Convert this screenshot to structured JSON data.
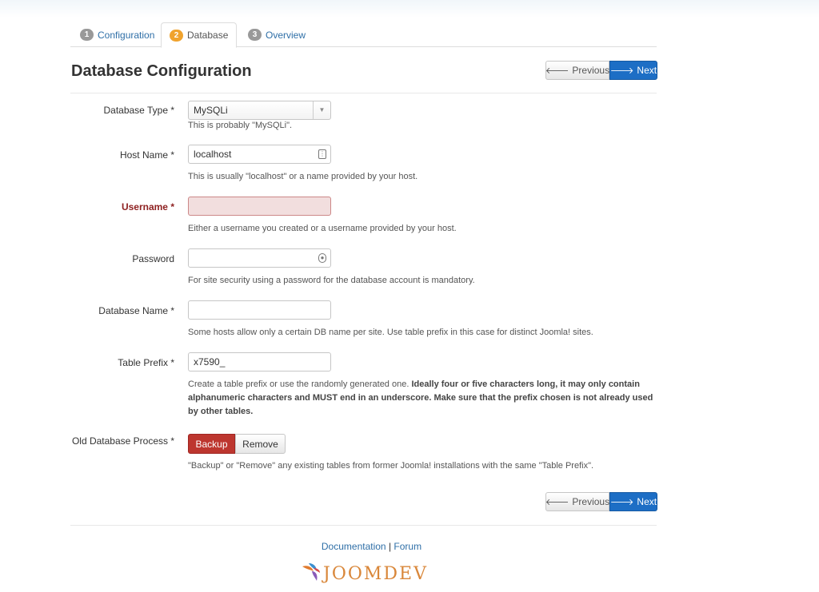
{
  "tabs": [
    {
      "num": "1",
      "label": "Configuration"
    },
    {
      "num": "2",
      "label": "Database"
    },
    {
      "num": "3",
      "label": "Overview"
    }
  ],
  "page_title": "Database Configuration",
  "nav": {
    "previous": "Previous",
    "next": "Next"
  },
  "fields": {
    "db_type": {
      "label": "Database Type *",
      "value": "MySQLi",
      "help": "This is probably \"MySQLi\"."
    },
    "host": {
      "label": "Host Name *",
      "value": "localhost",
      "help": "This is usually \"localhost\" or a name provided by your host."
    },
    "username": {
      "label": "Username *",
      "value": "",
      "help": "Either a username you created or a username provided by your host."
    },
    "password": {
      "label": "Password",
      "value": "",
      "help": "For site security using a password for the database account is mandatory."
    },
    "db_name": {
      "label": "Database Name *",
      "value": "",
      "help": "Some hosts allow only a certain DB name per site. Use table prefix in this case for distinct Joomla! sites."
    },
    "prefix": {
      "label": "Table Prefix *",
      "value": "x7590_",
      "help_plain": "Create a table prefix or use the randomly generated one.",
      "help_bold": "Ideally four or five characters long, it may only contain alphanumeric characters and MUST end in an underscore. Make sure that the prefix chosen is not already used by other tables."
    },
    "old_db": {
      "label": "Old Database Process *",
      "backup": "Backup",
      "remove": "Remove",
      "help": "\"Backup\" or \"Remove\" any existing tables from former Joomla! installations with the same \"Table Prefix\"."
    }
  },
  "footer": {
    "documentation": "Documentation",
    "separator": "|",
    "forum": "Forum",
    "logo_text": "JOOMDEV"
  },
  "colors": {
    "accent": "#1d6ec5",
    "active_step": "#f0a32e",
    "error": "#8e2121",
    "danger_button": "#bd362f",
    "logo": "#d9873a"
  }
}
